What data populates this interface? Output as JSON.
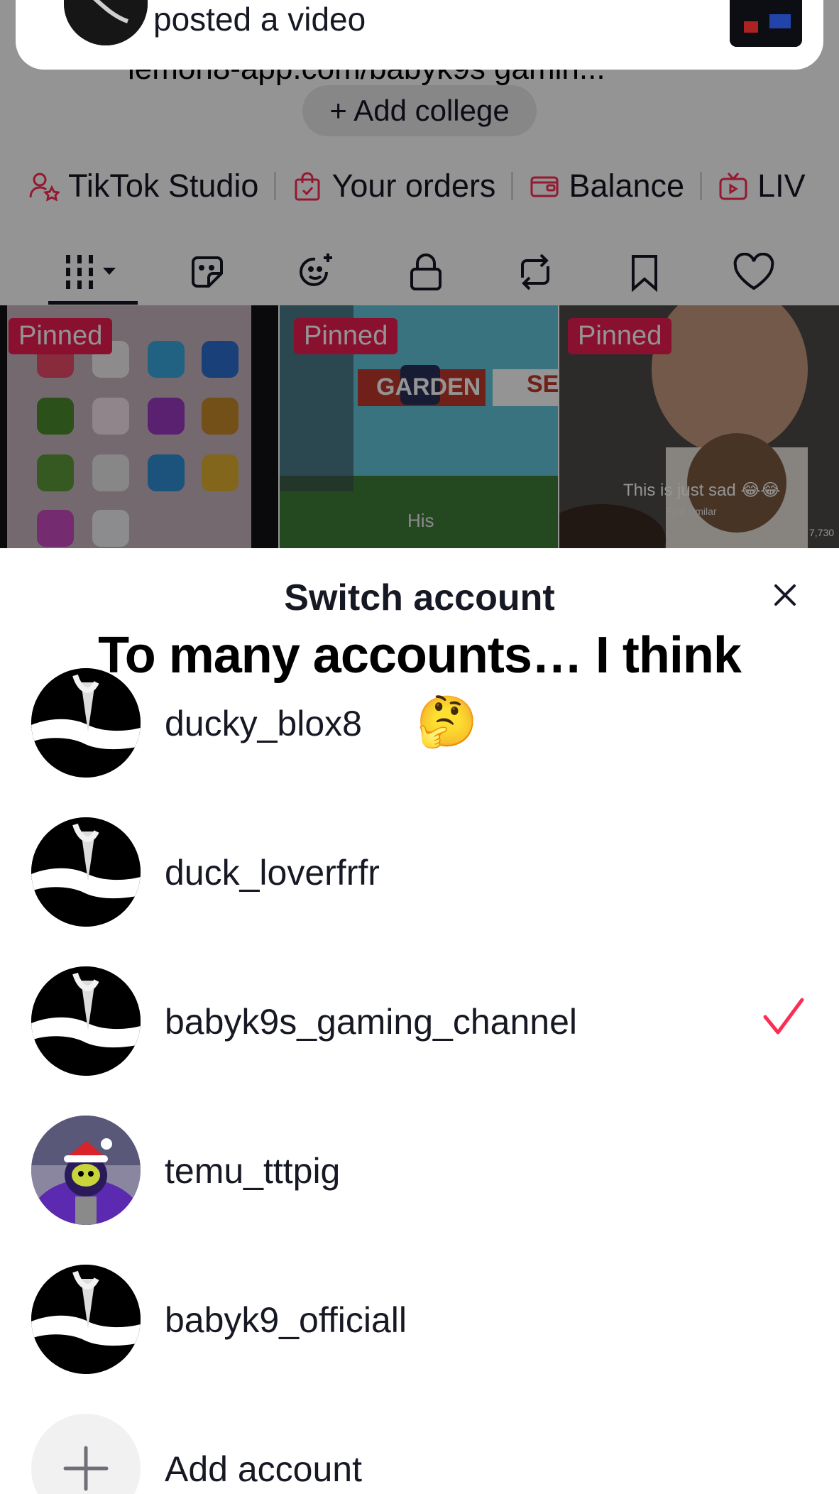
{
  "notification": {
    "text": "posted a video"
  },
  "profile": {
    "link_text": "lemon8-app.com/babyk9s gamin...",
    "add_college": "+ Add college",
    "quick_links": [
      {
        "icon": "person-star-icon",
        "label": "TikTok Studio"
      },
      {
        "icon": "shopping-bag-icon",
        "label": "Your orders"
      },
      {
        "icon": "wallet-icon",
        "label": "Balance"
      },
      {
        "icon": "live-tv-icon",
        "label": "LIV"
      }
    ],
    "tabs": [
      "videos-grid-icon",
      "sticker-icon",
      "face-sparkle-icon",
      "lock-icon",
      "repost-icon",
      "bookmark-icon",
      "heart-icon"
    ],
    "pinned_label": "Pinned",
    "thumbnails": [
      {
        "caption": ""
      },
      {
        "caption": "His",
        "game_text": "GARDEN",
        "sell_text": "SEL"
      },
      {
        "caption": "This is just sad 😂😂",
        "sub": "Find similar",
        "likes": "7,730"
      }
    ]
  },
  "sheet": {
    "title": "Switch account",
    "caption": "To many accounts… I think",
    "accounts": [
      {
        "name": "ducky_blox8",
        "emoji": "🤔",
        "active": false
      },
      {
        "name": "duck_loverfrfr",
        "active": false
      },
      {
        "name": "babyk9s_gaming_channel",
        "active": true
      },
      {
        "name": "temu_tttpig",
        "active": false
      },
      {
        "name": "babyk9_officiall",
        "active": false
      }
    ],
    "add_account": "Add account"
  },
  "colors": {
    "accent": "#fe2c55",
    "pinned": "#ee1d52",
    "text": "#161823"
  }
}
